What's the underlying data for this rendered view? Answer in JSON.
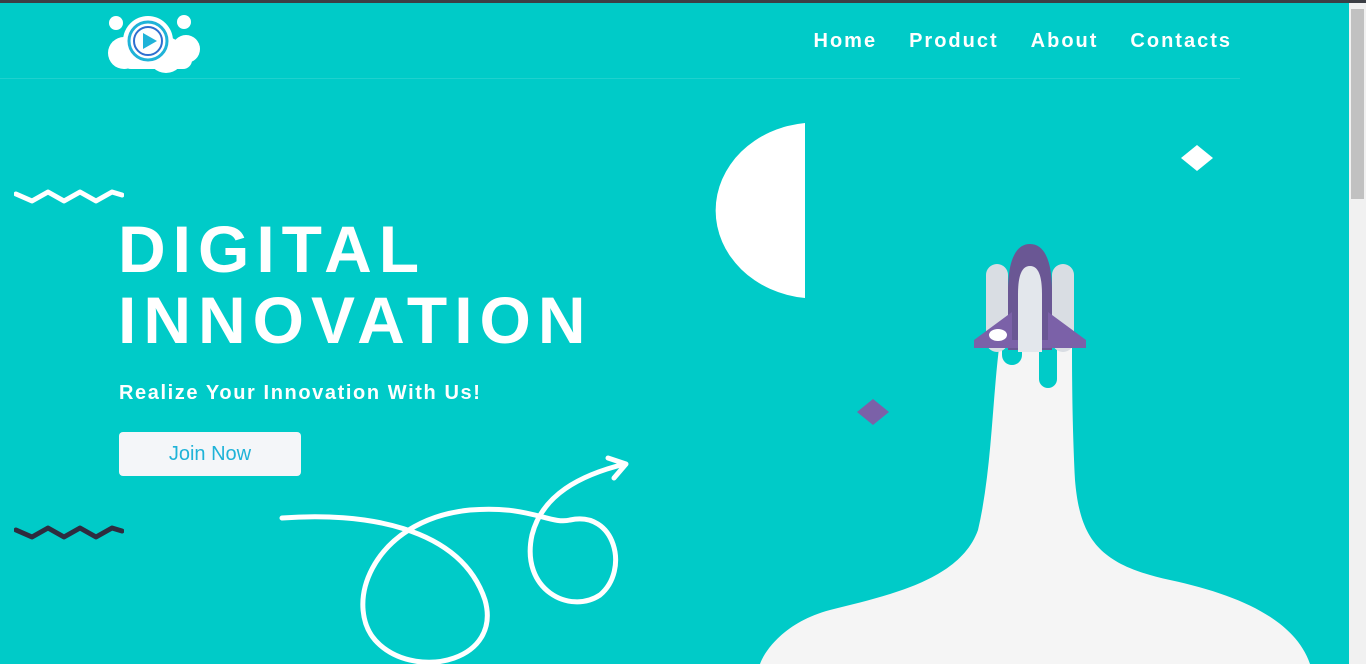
{
  "nav": {
    "items": [
      {
        "label": "Home"
      },
      {
        "label": "Product"
      },
      {
        "label": "About"
      },
      {
        "label": "Contacts"
      }
    ]
  },
  "hero": {
    "title_line1": "DIGITAL",
    "title_line2": "INNOVATION",
    "subtitle": "Realize Your Innovation With Us!",
    "cta_label": "Join Now"
  },
  "colors": {
    "background": "#00cbc8",
    "accent": "#1fb3d8",
    "purple": "#7b61a8",
    "dark": "#2e2c3f",
    "white": "#ffffff"
  },
  "icons": {
    "logo": "cloud-play-icon",
    "rocket": "rocket-icon"
  }
}
